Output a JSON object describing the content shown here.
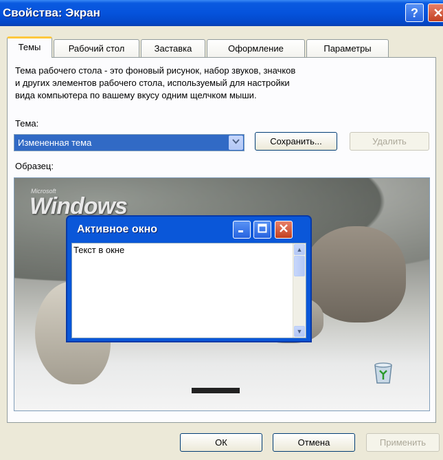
{
  "window": {
    "title": "Свойства: Экран",
    "help_glyph": "?",
    "close_glyph": "✕"
  },
  "tabs": [
    {
      "label": "Темы",
      "active": true
    },
    {
      "label": "Рабочий стол",
      "active": false
    },
    {
      "label": "Заставка",
      "active": false
    },
    {
      "label": "Оформление",
      "active": false
    },
    {
      "label": "Параметры",
      "active": false
    }
  ],
  "themes": {
    "description_lines": [
      "Тема рабочего стола - это фоновый рисунок, набор звуков, значков",
      "и других элементов рабочего стола, используемый для настройки",
      "вида компьютера по вашему вкусу одним щелчком мыши."
    ],
    "theme_label": "Тема:",
    "theme_selected": "Измененная тема",
    "save_label": "Сохранить...",
    "delete_label": "Удалить",
    "sample_label": "Образец:"
  },
  "preview": {
    "brand_small": "Microsoft",
    "brand": "Windows",
    "window_title": "Активное окно",
    "window_text": "Текст в окне"
  },
  "buttons": {
    "ok": "ОК",
    "cancel": "Отмена",
    "apply": "Применить"
  },
  "colors": {
    "titlebar": "#0553dc",
    "selection": "#316ac5",
    "dialog_bg": "#ece9d8",
    "active_tab_accent": "#ffc83c",
    "close_button": "#c2401f"
  },
  "icons": [
    "help-icon",
    "close-icon",
    "dropdown-arrow-icon",
    "minimize-icon",
    "maximize-icon",
    "recycle-bin-icon",
    "scroll-up-icon",
    "scroll-down-icon"
  ]
}
